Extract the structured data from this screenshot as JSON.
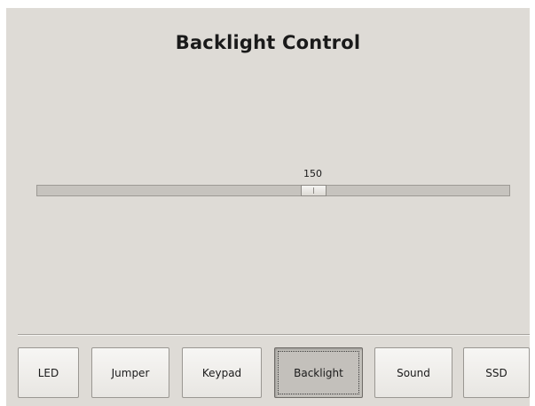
{
  "window": {
    "title": "Backlight Control"
  },
  "slider": {
    "value": 150,
    "value_label": "150",
    "min": 0,
    "max": 255
  },
  "nav": {
    "buttons": [
      {
        "label": "LED",
        "active": false
      },
      {
        "label": "Jumper",
        "active": false
      },
      {
        "label": "Keypad",
        "active": false
      },
      {
        "label": "Backlight",
        "active": true
      },
      {
        "label": "Sound",
        "active": false
      },
      {
        "label": "SSD",
        "active": false
      }
    ]
  },
  "colors": {
    "window_bg": "#dedbd6",
    "track": "#c6c3be",
    "active_button": "#c3c0bb"
  }
}
